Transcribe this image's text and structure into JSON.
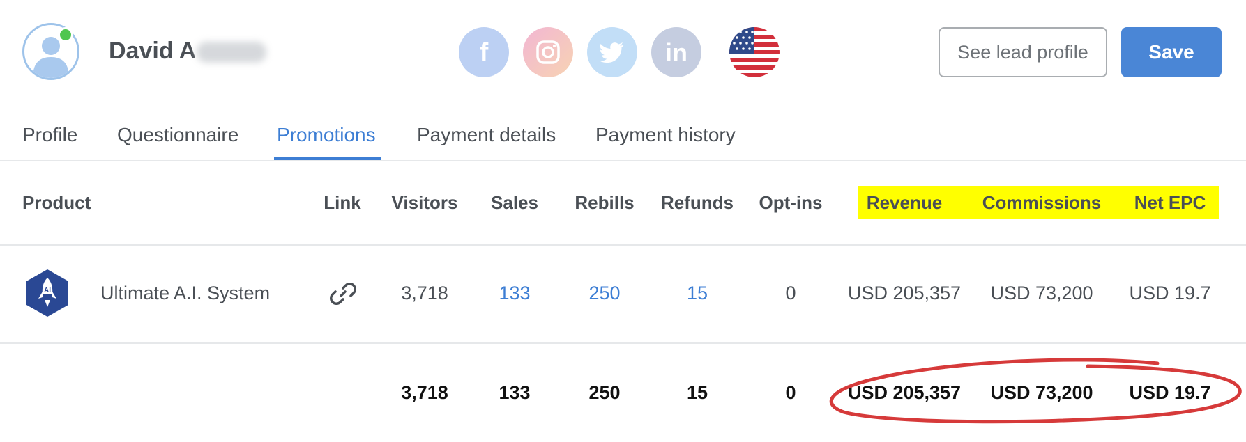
{
  "header": {
    "user_name": "David A",
    "see_profile_label": "See lead profile",
    "save_label": "Save",
    "social": [
      {
        "name": "facebook",
        "color": "#bcd0f3",
        "glyph": "f"
      },
      {
        "name": "instagram",
        "color": "#f4c1c8",
        "glyph": "instagram"
      },
      {
        "name": "twitter",
        "color": "#c2def7",
        "glyph": "twitter"
      },
      {
        "name": "linkedin",
        "color": "#c5cde0",
        "glyph": "in"
      }
    ],
    "flag": "us-flag-icon",
    "online_color": "#4fc64f"
  },
  "tabs": [
    {
      "label": "Profile",
      "active": false
    },
    {
      "label": "Questionnaire",
      "active": false
    },
    {
      "label": "Promotions",
      "active": true
    },
    {
      "label": "Payment details",
      "active": false
    },
    {
      "label": "Payment history",
      "active": false
    }
  ],
  "table": {
    "headers": {
      "product": "Product",
      "link": "Link",
      "visitors": "Visitors",
      "sales": "Sales",
      "rebills": "Rebills",
      "refunds": "Refunds",
      "optins": "Opt-ins",
      "revenue": "Revenue",
      "commissions": "Commissions",
      "net_epc": "Net EPC"
    },
    "rows": [
      {
        "product": "Ultimate A.I. System",
        "logo_text": "AI",
        "visitors": "3,718",
        "sales": "133",
        "rebills": "250",
        "refunds": "15",
        "optins": "0",
        "revenue": "USD 205,357",
        "commissions": "USD 73,200",
        "net_epc": "USD 19.7"
      }
    ],
    "totals": {
      "visitors": "3,718",
      "sales": "133",
      "rebills": "250",
      "refunds": "15",
      "optins": "0",
      "revenue": "USD 205,357",
      "commissions": "USD 73,200",
      "net_epc": "USD 19.7"
    },
    "highlight_color": "#ffff00",
    "annotation_color": "#d63a3a"
  }
}
